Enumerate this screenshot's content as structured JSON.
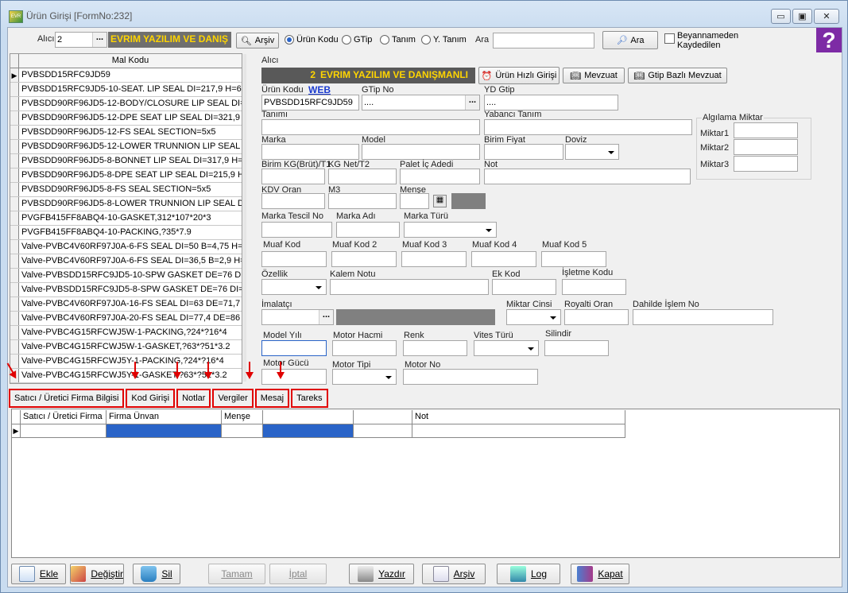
{
  "window": {
    "title": "Ürün Girişi [FormNo:232]",
    "minimize": "▭",
    "maximize": "▣",
    "close": "✕"
  },
  "toolbar": {
    "alici_label": "Alıcı",
    "alici_code": "2",
    "alici_name": "EVRIM YAZILIM VE DANIŞ",
    "arsiv_label": "Arşiv",
    "radio_urun_kodu": "Ürün Kodu",
    "radio_gtip": "GTip",
    "radio_tanim": "Tanım",
    "radio_y_tanim": "Y. Tanım",
    "ara_label": "Ara",
    "ara_value": "",
    "ara_button": "Ara",
    "beyanname_label_1": "Beyannameden",
    "beyanname_label_2": "Kaydedilen",
    "help": "?"
  },
  "grid": {
    "header": "Mal Kodu",
    "rows": [
      "PVBSDD15RFC9JD59",
      "PVBSDD15RFC9JD5-10-SEAT. LIP SEAL DI=217,9 H=6,0",
      "PVBSDD90RF96JD5-12-BODY/CLOSURE LIP SEAL DI=4",
      "PVBSDD90RF96JD5-12-DPE SEAT LIP SEAL DI=321,9 H=",
      "PVBSDD90RF96JD5-12-FS SEAL SECTION=5x5",
      "PVBSDD90RF96JD5-12-LOWER TRUNNION LIP SEAL D",
      "PVBSDD90RF96JD5-8-BONNET LIP SEAL DI=317,9 H=6",
      "PVBSDD90RF96JD5-8-DPE SEAT LIP SEAL DI=215,9 H=",
      "PVBSDD90RF96JD5-8-FS SEAL SECTION=5x5",
      "PVBSDD90RF96JD5-8-LOWER TRUNNION LIP SEAL DI",
      "PVGFB415FF8ABQ4-10-GASKET,312*107*20*3",
      "PVGFB415FF8ABQ4-10-PACKING,?35*7.9",
      "Valve-PVBC4V60RF97J0A-6-FS SEAL DI=50 B=4,75 H=3,",
      "Valve-PVBC4V60RF97J0A-6-FS SEAL DI=36,5 B=2,9 H=7",
      "Valve-PVBSDD15RFC9JD5-10-SPW GASKET DE=76 DI=",
      "Valve-PVBSDD15RFC9JD5-8-SPW GASKET DE=76 DI=6",
      "Valve-PVBC4V60RF97J0A-16-FS SEAL DI=63 DE=71,7 H",
      "Valve-PVBC4V60RF97J0A-20-FS SEAL DI=77,4 DE=86 H",
      "Valve-PVBC4G15RFCWJ5W-1-PACKING,?24*?16*4",
      "Valve-PVBC4G15RFCWJ5W-1-GASKET,?63*?51*3.2",
      "Valve-PVBC4G15RFCWJ5Y-1-PACKING,?24*?16*4",
      "Valve-PVBC4G15RFCWJ5Y-1-GASKET,?63*?51*3.2"
    ]
  },
  "form": {
    "alici_label": "Alıcı",
    "alici_code": "2",
    "alici_name": "EVRIM YAZILIM VE DANIŞMANLI",
    "btn_hizli": "Ürün Hızlı Girişi",
    "btn_mevzuat": "Mevzuat",
    "btn_gtip_mevzuat": "Gtip Bazlı Mevzuat",
    "urun_kodu_label": "Ürün Kodu",
    "web_link": "WEB",
    "urun_kodu_value": "PVBSDD15RFC9JD59",
    "gtip_label": "GTip No",
    "gtip_value": "....",
    "yd_gtip_label": "YD Gtip",
    "yd_gtip_value": "....",
    "tanimi_label": "Tanımı",
    "yabanci_tanim_label": "Yabancı Tanım",
    "algilama_label": "Algılama Miktar",
    "miktar1": "Miktar1",
    "miktar2": "Miktar2",
    "miktar3": "Miktar3",
    "marka_label": "Marka",
    "model_label": "Model",
    "birim_fiyat_label": "Birim Fiyat",
    "doviz_label": "Doviz",
    "birim_kg_label": "Birim KG(Brüt)/T1",
    "kg_net_label": "KG Net/T2",
    "palet_label": "Palet İç Adedi",
    "not_label": "Not",
    "kdv_label": "KDV Oran",
    "m3_label": "M3",
    "mense_label": "Menşe",
    "marka_tescil_label": "Marka Tescil No",
    "marka_adi_label": "Marka Adı",
    "marka_turu_label": "Marka Türü",
    "muaf1": "Muaf Kod",
    "muaf2": "Muaf Kod 2",
    "muaf3": "Muaf Kod 3",
    "muaf4": "Muaf Kod 4",
    "muaf5": "Muaf Kod 5",
    "ozellik_label": "Özellik",
    "kalem_notu_label": "Kalem Notu",
    "ek_kod_label": "Ek Kod",
    "isletme_kodu_label": "İşletme Kodu",
    "imalatci_label": "İmalatçı",
    "miktar_cinsi_label": "Miktar Cinsi",
    "royalti_label": "Royalti Oran",
    "dahilde_label": "Dahilde İşlem No",
    "model_yili_label": "Model Yılı",
    "motor_hacmi_label": "Motor Hacmi",
    "renk_label": "Renk",
    "vites_label": "Vites Türü",
    "silindir_label": "Silindir",
    "motor_gucu_label": "Motor Gücü",
    "motor_tipi_label": "Motor Tipi",
    "motor_no_label": "Motor No"
  },
  "tabs": [
    "Satıcı / Üretici Firma Bilgisi",
    "Kod Girişi",
    "Notlar",
    "Vergiler",
    "Mesaj",
    "Tareks"
  ],
  "subgrid": {
    "headers": [
      "Satıcı / Üretici Firma",
      "Firma Ünvan",
      "Menşe",
      "",
      "",
      "Not"
    ]
  },
  "bottom": {
    "ekle": "Ekle",
    "degistir": "Değiştir",
    "sil": "Sil",
    "tamam": "Tamam",
    "iptal": "İptal",
    "yazdir": "Yazdır",
    "arsiv": "Arşiv",
    "log": "Log",
    "kapat": "Kapat"
  },
  "colors": {
    "annotation": "#e00000",
    "selected_cell": "#2a64c8",
    "alici_bg": "#595959",
    "alici_text": "#ffd500"
  }
}
